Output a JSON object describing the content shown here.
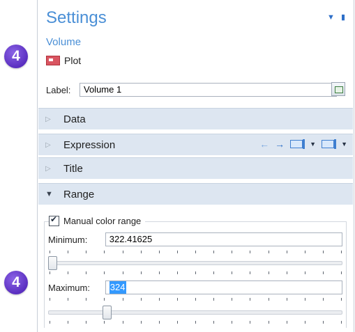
{
  "badges": [
    "4",
    "4"
  ],
  "header": {
    "title": "Settings",
    "subtitle": "Volume",
    "node_label": "Plot",
    "pin_icons": [
      "dropdown-arrow-icon",
      "pin-icon"
    ]
  },
  "label_row": {
    "label": "Label:",
    "value": "Volume 1"
  },
  "sections": {
    "data": "Data",
    "expression": "Expression",
    "title": "Title",
    "range": "Range"
  },
  "expression_tools": [
    "←",
    "→",
    "insert-expression-icon",
    "replace-expression-icon"
  ],
  "range": {
    "manual_color_range_label": "Manual color range",
    "manual_color_range_checked": true,
    "minimum_label": "Minimum:",
    "minimum_value": "322.41625",
    "maximum_label": "Maximum:",
    "maximum_value": "324",
    "minimum_slider_position": 0.0,
    "maximum_slider_position": 0.19
  },
  "colors": {
    "accent": "#4a8fd6",
    "section_bg": "#dde6f1",
    "badge": "#6c3fd4"
  }
}
